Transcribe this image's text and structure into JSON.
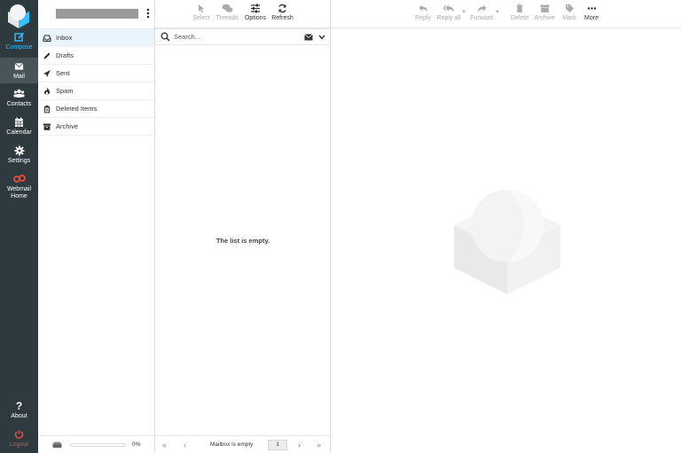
{
  "nav": {
    "compose": "Compose",
    "mail": "Mail",
    "contacts": "Contacts",
    "calendar": "Calendar",
    "settings": "Settings",
    "webmail_home": [
      "Webmail",
      "Home"
    ],
    "about": "About",
    "logout": "Logout",
    "colors": {
      "accent": "#37beff",
      "logout": "#e84c3d",
      "background": "#2f3a3f",
      "active": "#495459"
    }
  },
  "folders": [
    {
      "label": "Inbox",
      "icon": "inbox-icon",
      "active": true
    },
    {
      "label": "Drafts",
      "icon": "pencil-icon"
    },
    {
      "label": "Sent",
      "icon": "paper-plane-icon"
    },
    {
      "label": "Spam",
      "icon": "fire-icon"
    },
    {
      "label": "Deleted Items",
      "icon": "trash-icon"
    },
    {
      "label": "Archive",
      "icon": "archive-icon"
    }
  ],
  "quota": {
    "percent_label": "0%",
    "fraction": 0
  },
  "list_toolbar": {
    "select": "Select",
    "threads": "Threads",
    "options": "Options",
    "refresh": "Refresh"
  },
  "search": {
    "placeholder": "Search..."
  },
  "list": {
    "empty_message": "The list is empty."
  },
  "pager": {
    "status": "Mailbox is empty",
    "page": "1"
  },
  "message_toolbar": {
    "reply": "Reply",
    "reply_all": "Reply all",
    "forward": "Forward",
    "delete": "Delete",
    "archive": "Archive",
    "mark": "Mark",
    "more": "More"
  }
}
